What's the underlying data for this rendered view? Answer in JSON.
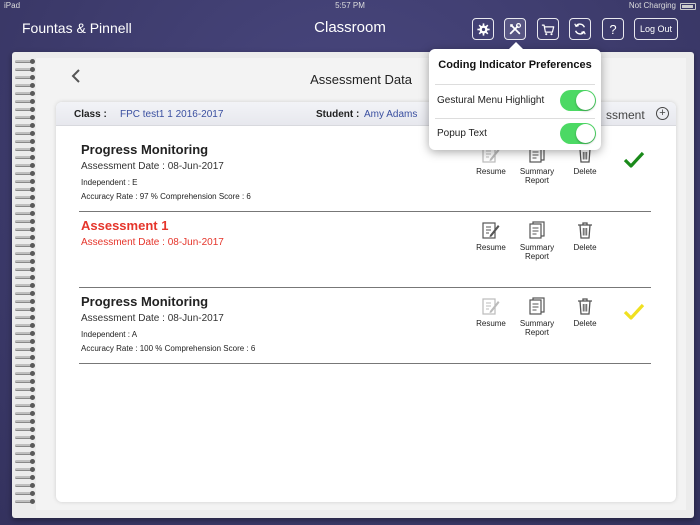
{
  "status_bar": {
    "device": "iPad",
    "time": "5:57 PM",
    "battery": "Not Charging"
  },
  "nav": {
    "brand": "Fountas & Pinnell",
    "title": "Classroom",
    "icons": [
      "gear-icon",
      "tools-icon",
      "cart-icon",
      "sync-icon",
      "help-icon"
    ],
    "help_glyph": "?",
    "logout_label": "Log Out"
  },
  "page": {
    "title": "Assessment Data",
    "class_label": "Class :",
    "class_value": "FPC test1 1 2016-2017",
    "student_label": "Student :",
    "student_value": "Amy Adams",
    "add_assessment_label": "ssment"
  },
  "actions": {
    "resume": "Resume",
    "summary_line1": "Summary",
    "summary_line2": "Report",
    "delete": "Delete"
  },
  "assessments": [
    {
      "title": "Progress Monitoring",
      "date": "Assessment Date : 08-Jun-2017",
      "independent": "Independent : E",
      "accuracy": "Accuracy Rate : 97 %   Comprehension Score : 6",
      "status": "complete",
      "check_color": "#1a8a1a"
    },
    {
      "title": "Assessment 1",
      "date": "Assessment Date : 08-Jun-2017",
      "status": "incomplete"
    },
    {
      "title": "Progress Monitoring",
      "date": "Assessment Date : 08-Jun-2017",
      "independent": "Independent : A",
      "accuracy": "Accuracy Rate : 100 %  Comprehension Score : 6",
      "status": "complete",
      "check_color": "#f0e020"
    }
  ],
  "popover": {
    "title": "Coding Indicator Preferences",
    "options": [
      {
        "label": "Gestural Menu Highlight",
        "on": true
      },
      {
        "label": "Popup Text",
        "on": true
      }
    ]
  },
  "colors": {
    "accent_blue": "#3a4fa0",
    "incomplete_red": "#e5352b",
    "toggle_on": "#4cd964"
  }
}
